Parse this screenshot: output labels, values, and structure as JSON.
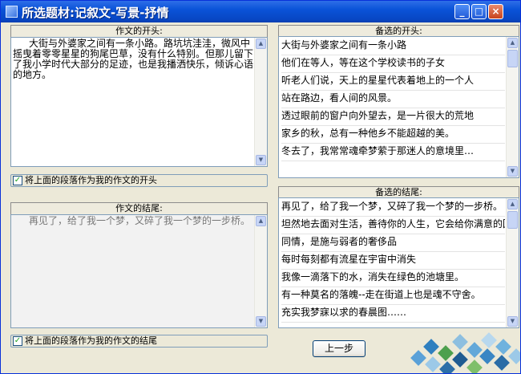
{
  "window": {
    "title": "所选题材:记叙文-写景-抒情",
    "minimize_glyph": "_",
    "maximize_glyph": "□",
    "close_glyph": "×"
  },
  "opening": {
    "header": "作文的开头:",
    "text": "大街与外婆家之间有一条小路。路坑坑洼洼，微风中摇曳着零零星星的狗尾巴草，没有什么特别。但那儿留下了我小学时代大部分的足迹，也是我播洒快乐，倾诉心语的地方。",
    "checkbox_label": "将上面的段落作为我的作文的开头",
    "checked": true
  },
  "ending": {
    "header": "作文的结尾:",
    "text": "再见了，给了我一个梦，又碎了我一个梦的一步桥。",
    "checkbox_label": "将上面的段落作为我的作文的结尾",
    "checked": true
  },
  "candidate_openings": {
    "header": "备选的开头:",
    "items": [
      "大街与外婆家之间有一条小路",
      "他们在等人，等在这个学校读书的子女",
      "听老人们说，天上的星星代表着地上的一个人",
      "站在路边，看人间的风景。",
      "透过眼前的窗户向外望去，是一片很大的荒地",
      "家乡的秋，总有一种他乡不能超越的美。",
      "冬去了，我常常魂牵梦萦于那迷人的意境里…"
    ]
  },
  "candidate_endings": {
    "header": "备选的结尾:",
    "items": [
      "再见了，给了我一个梦，又碎了我一个梦的一步桥。",
      "坦然地去面对生活，善待你的人生，它会给你满意的回答的。",
      "同情，是施与弱者的奢侈品",
      "每时每刻都有流星在宇宙中消失",
      "我像一滴落下的水，消失在绿色的池塘里。",
      "有一种莫名的落魄--走在街道上也是魂不守舍。",
      "充实我梦寐以求的春晨图……"
    ]
  },
  "buttons": {
    "back": "上一步"
  },
  "icons": {
    "check": "✓",
    "up_arrow": "▲",
    "down_arrow": "▼"
  }
}
